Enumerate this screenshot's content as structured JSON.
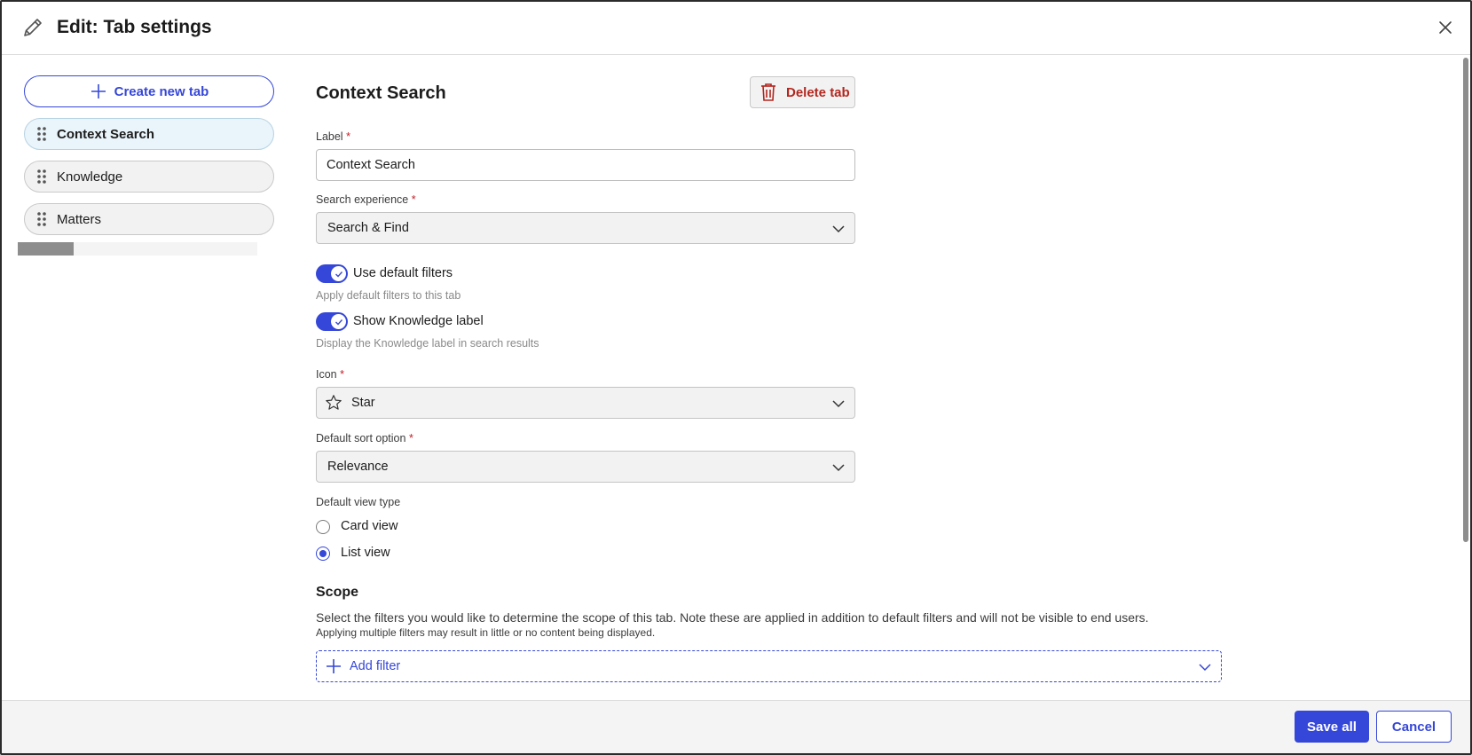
{
  "header": {
    "title": "Edit: Tab settings",
    "icon": "pencil-icon",
    "close_icon": "close-icon"
  },
  "sidebar": {
    "create_label": "Create new tab",
    "tabs": [
      {
        "label": "Context Search",
        "active": true
      },
      {
        "label": "Knowledge",
        "active": false
      },
      {
        "label": "Matters",
        "active": false
      }
    ]
  },
  "form": {
    "section_title": "Context Search",
    "delete_label": "Delete tab",
    "label_field": {
      "label": "Label",
      "required_mark": "*",
      "value": "Context Search"
    },
    "search_experience": {
      "label": "Search experience",
      "required_mark": "*",
      "value": "Search & Find"
    },
    "use_default_filters": {
      "label": "Use default filters",
      "help": "Apply default filters to this tab",
      "on": true
    },
    "show_knowledge_label": {
      "label": "Show Knowledge label",
      "help": "Display the Knowledge label in search results",
      "on": true
    },
    "icon": {
      "label": "Icon",
      "required_mark": "*",
      "value": "Star",
      "icon": "star-icon"
    },
    "default_sort": {
      "label": "Default sort option",
      "required_mark": "*",
      "value": "Relevance"
    },
    "default_view": {
      "label": "Default view type",
      "options": [
        {
          "label": "Card view",
          "checked": false
        },
        {
          "label": "List view",
          "checked": true
        }
      ]
    }
  },
  "scope": {
    "title": "Scope",
    "description": "Select the filters you would like to determine the scope of this tab. Note these are applied in addition to default filters and will not be visible to end users.",
    "note": "Applying multiple filters may result in little or no content being displayed.",
    "add_filter_label": "Add filter"
  },
  "footer": {
    "save_label": "Save all",
    "cancel_label": "Cancel"
  },
  "colors": {
    "accent": "#3547d8",
    "danger": "#b3261e",
    "required": "#c0212b",
    "active_tab_bg": "#e9f4fb"
  }
}
